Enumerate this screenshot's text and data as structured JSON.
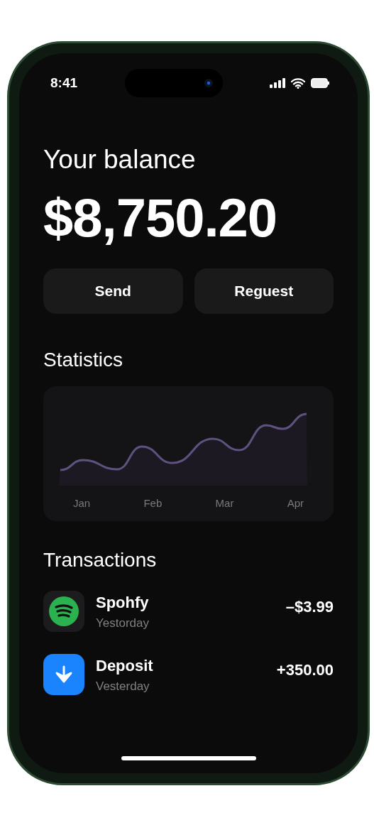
{
  "status_bar": {
    "time": "8:41"
  },
  "balance": {
    "title": "Your balance",
    "amount": "$8,750.20"
  },
  "actions": [
    {
      "label": "Send"
    },
    {
      "label": "Reguest"
    }
  ],
  "statistics": {
    "title": "Statistics",
    "months": [
      "Jan",
      "Feb",
      "Mar",
      "Apr"
    ]
  },
  "transactions": {
    "title": "Transactions",
    "items": [
      {
        "kind": "music",
        "name": "Spohfy",
        "date": "Yestorday",
        "amount": "–$3.99"
      },
      {
        "kind": "deposit",
        "name": "Deposit",
        "date": "Vesterday",
        "amount": "+350.00"
      }
    ]
  }
}
